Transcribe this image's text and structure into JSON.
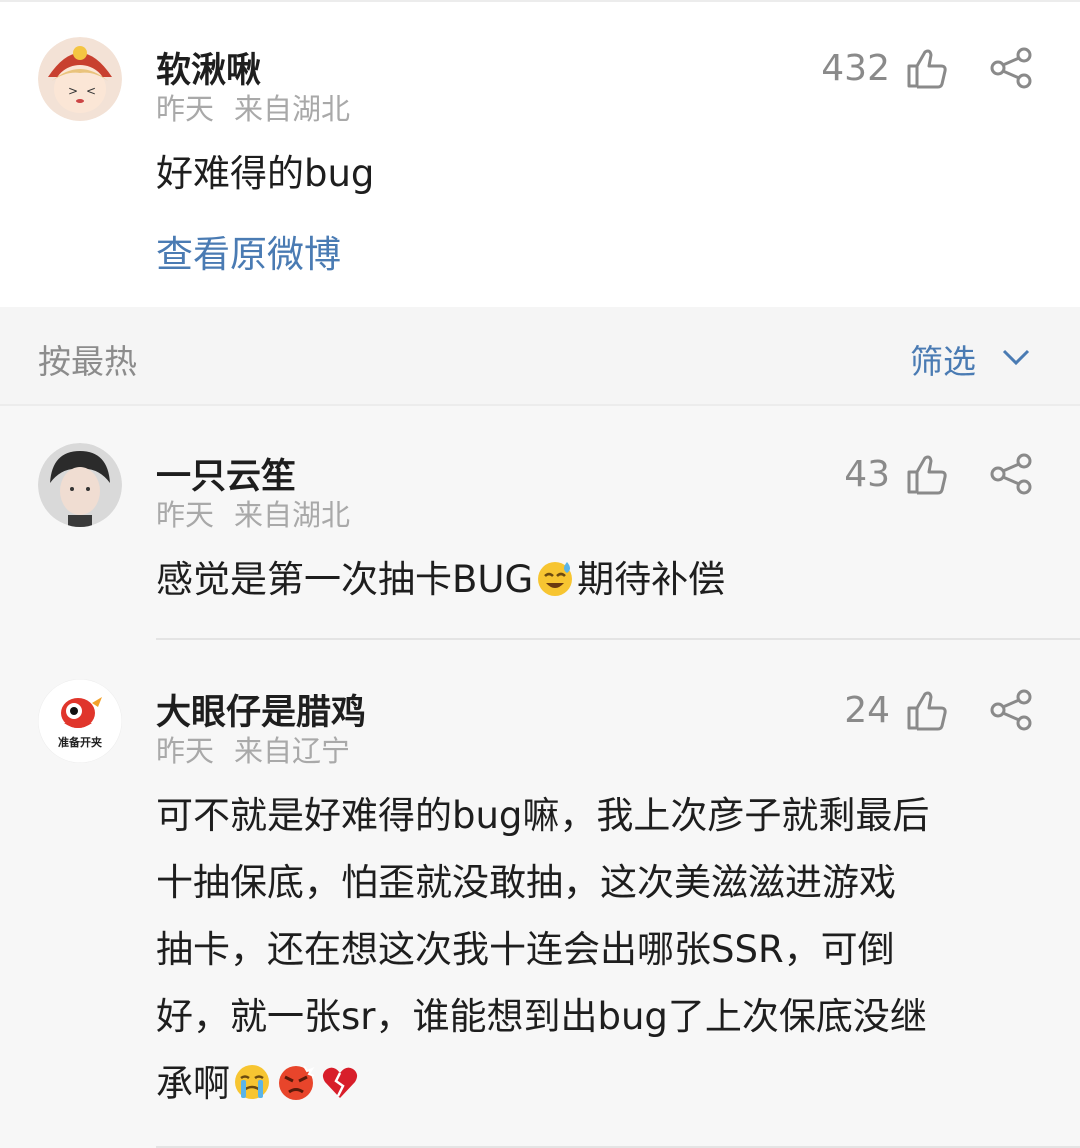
{
  "original_post": {
    "username": "软湫啾",
    "time": "昨天",
    "location": "来自湖北",
    "likes": "432",
    "text": "好难得的bug",
    "view_original": "查看原微博"
  },
  "sort_bar": {
    "sort_label": "按最热",
    "filter_label": "筛选"
  },
  "comments": [
    {
      "username": "一只云笙",
      "time": "昨天",
      "location": "来自湖北",
      "likes": "43",
      "text_before": "感觉是第一次抽卡BUG",
      "emoji": "sweat-laugh-emoji",
      "text_after": "期待补偿"
    },
    {
      "username": "大眼仔是腊鸡",
      "time": "昨天",
      "location": "来自辽宁",
      "likes": "24",
      "avatar_text": "准备开夹",
      "lines": [
        "可不就是好难得的bug嘛，我上次彦子就剩最后",
        "十抽保底，怕歪就没敢抽，这次美滋滋进游戏",
        "抽卡，还在想这次我十连会出哪张SSR，可倒",
        "好，就一张sr，谁能想到出bug了上次保底没继",
        "承啊"
      ],
      "emojis": [
        "crying-emoji",
        "angry-emoji",
        "broken-heart-emoji"
      ]
    }
  ],
  "colors": {
    "link": "#4a7bb3",
    "muted": "#a9a9a9",
    "background": "#f7f7f7"
  }
}
